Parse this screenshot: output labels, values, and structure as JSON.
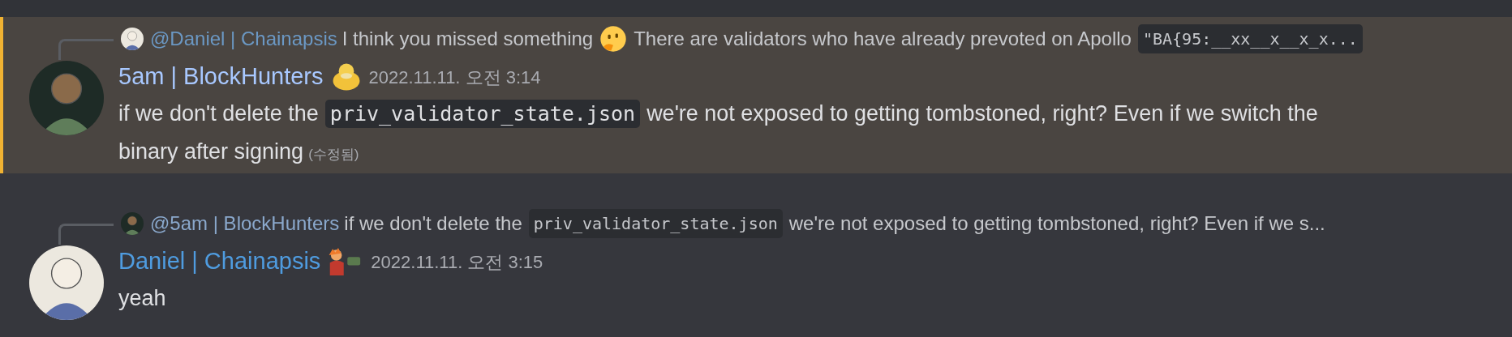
{
  "messages": [
    {
      "highlighted": true,
      "reply": {
        "author": "@Daniel | Chainapsis",
        "color": "#6b98c4",
        "segments": [
          {
            "kind": "text",
            "text": "I think you missed something"
          },
          {
            "kind": "emoji"
          },
          {
            "kind": "text",
            "text": "There are validators who have already prevoted on Apollo"
          },
          {
            "kind": "code",
            "text": "\"BA{95:__xx__x__x_x..."
          }
        ]
      },
      "author": "5am | BlockHunters",
      "color": "#a8c8ff",
      "badge": {
        "kind": "duck"
      },
      "timestamp": "2022.11.11. 오전 3:14",
      "body_lines": [
        [
          {
            "kind": "text",
            "text": "if we don't delete the"
          },
          {
            "kind": "code",
            "text": "priv_validator_state.json"
          },
          {
            "kind": "text",
            "text": "we're not exposed to getting tombstoned, right? Even if we switch the"
          }
        ],
        [
          {
            "kind": "text",
            "text": "binary after signing"
          }
        ]
      ],
      "edited": "(수정됨)"
    },
    {
      "highlighted": false,
      "reply": {
        "author": "@5am | BlockHunters",
        "color": "#8aa8cc",
        "segments": [
          {
            "kind": "text",
            "text": "if we don't delete the"
          },
          {
            "kind": "code",
            "text": "priv_validator_state.json"
          },
          {
            "kind": "text",
            "text": "we're not exposed to getting tombstoned, right? Even if we s..."
          }
        ]
      },
      "author": "Daniel | Chainapsis",
      "color": "#4f9ce0",
      "badge": {
        "kind": "figure"
      },
      "timestamp": "2022.11.11. 오전 3:15",
      "body_lines": [
        [
          {
            "kind": "text",
            "text": "yeah"
          }
        ]
      ]
    }
  ]
}
